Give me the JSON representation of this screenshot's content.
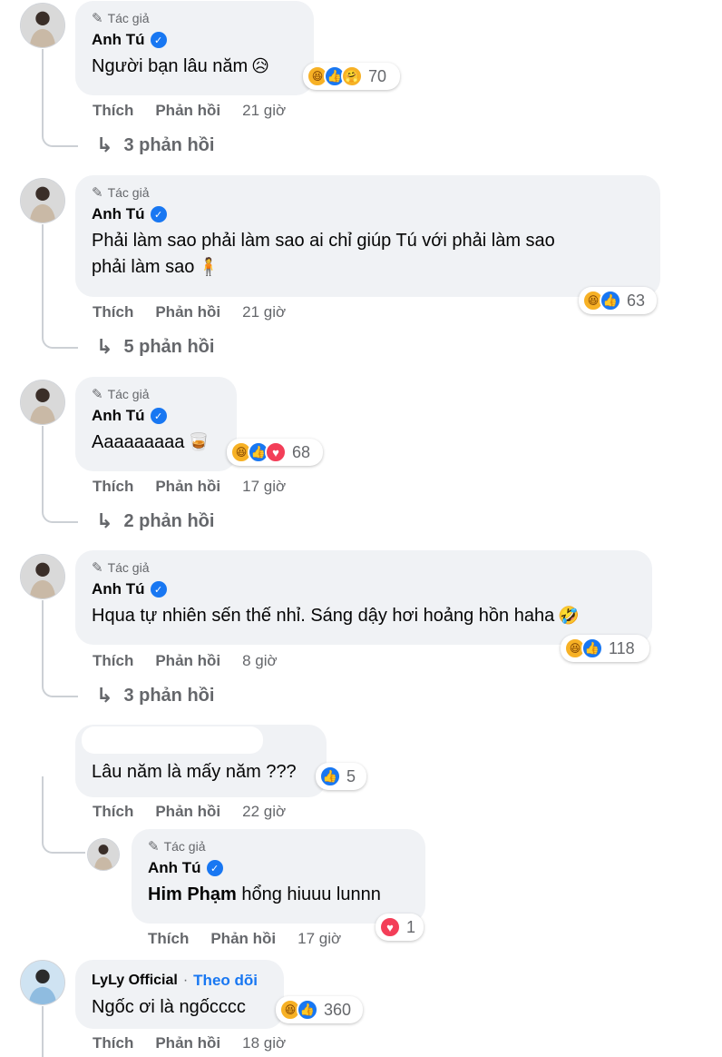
{
  "comments": [
    {
      "badge": "Tác giả",
      "name": "Anh Tú",
      "text": "Người bạn lâu năm",
      "emoji": "😥",
      "reactions": [
        "haha",
        "like",
        "care"
      ],
      "count": "70",
      "like": "Thích",
      "reply": "Phản hồi",
      "time": "21 giờ",
      "replies": "3 phản hồi"
    },
    {
      "badge": "Tác giả",
      "name": "Anh Tú",
      "text_line1": "Phải làm sao phải làm sao ai chỉ giúp Tú với phải làm sao",
      "text_line2": "phải làm sao",
      "emoji": "🧍",
      "reactions": [
        "haha",
        "like"
      ],
      "count": "63",
      "like": "Thích",
      "reply": "Phản hồi",
      "time": "21 giờ",
      "replies": "5 phản hồi"
    },
    {
      "badge": "Tác giả",
      "name": "Anh Tú",
      "text": "Aaaaaaaaa",
      "emoji": "🥃",
      "reactions": [
        "haha",
        "like",
        "love"
      ],
      "count": "68",
      "like": "Thích",
      "reply": "Phản hồi",
      "time": "17 giờ",
      "replies": "2 phản hồi"
    },
    {
      "badge": "Tác giả",
      "name": "Anh Tú",
      "text": "Hqua tự nhiên sến thế nhỉ. Sáng dậy hơi hoảng hồn haha",
      "emoji": "🤣",
      "reactions": [
        "haha",
        "like"
      ],
      "count": "118",
      "like": "Thích",
      "reply": "Phản hồi",
      "time": "8 giờ",
      "replies": "3 phản hồi"
    },
    {
      "text": "Lâu năm là mấy năm ???",
      "reactions": [
        "like"
      ],
      "count": "5",
      "like": "Thích",
      "reply": "Phản hồi",
      "time": "22 giờ"
    }
  ],
  "nested_reply": {
    "badge": "Tác giả",
    "name": "Anh Tú",
    "mention": "Him Phạm",
    "text": "hổng hiuuu lunnn",
    "reactions": [
      "love"
    ],
    "count": "1",
    "like": "Thích",
    "reply": "Phản hồi",
    "time": "17 giờ"
  },
  "last_comment": {
    "name": "LyLy Official",
    "separator": "·",
    "follow": "Theo dõi",
    "text": "Ngốc ơi là ngốcccc",
    "reactions": [
      "haha",
      "like"
    ],
    "count": "360",
    "like": "Thích",
    "reply": "Phản hồi",
    "time": "18 giờ"
  },
  "colors": {
    "bubble": "#f0f2f5",
    "secondary_text": "#65676b",
    "brand_blue": "#1877f2",
    "love_red": "#f33e58",
    "haha_yellow": "#f7b125"
  }
}
